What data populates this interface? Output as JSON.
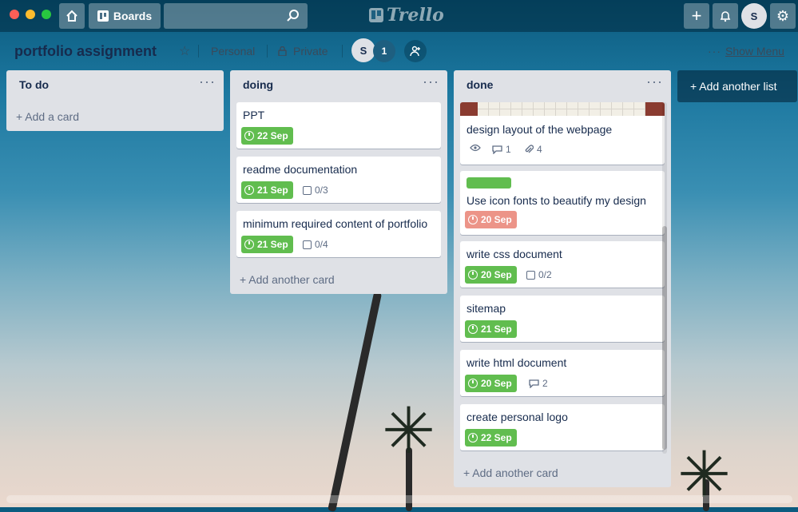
{
  "topbar": {
    "boards_label": "Boards",
    "logo_text": "Trello",
    "user_initial": "S",
    "search_placeholder": ""
  },
  "board": {
    "title": "portfolio assignment",
    "team": "Personal",
    "visibility": "Private",
    "member_initial": "S",
    "member_count": "1",
    "show_menu": "Show Menu"
  },
  "lists": {
    "todo": {
      "title": "To do",
      "add_label": "+ Add a card"
    },
    "doing": {
      "title": "doing",
      "add_label": "+ Add another card",
      "cards": [
        {
          "title": "PPT",
          "due": "22 Sep"
        },
        {
          "title": "readme documentation",
          "due": "21 Sep",
          "checklist": "0/3"
        },
        {
          "title": "minimum required content of portfolio",
          "due": "21 Sep",
          "checklist": "0/4"
        }
      ]
    },
    "done": {
      "title": "done",
      "add_label": "+ Add another card",
      "cards": [
        {
          "title": "design layout of the webpage",
          "comments": "1",
          "attachments": "4"
        },
        {
          "title": "Use icon fonts to beautify my design",
          "due": "20 Sep"
        },
        {
          "title": "write css document",
          "due": "20 Sep",
          "checklist": "0/2"
        },
        {
          "title": "sitemap",
          "due": "21 Sep"
        },
        {
          "title": "write html document",
          "due": "20 Sep",
          "comments": "2"
        },
        {
          "title": "create personal logo",
          "due": "22 Sep"
        }
      ]
    }
  },
  "add_list_label": "+ Add another list",
  "colors": {
    "due_green": "#61bd4f",
    "due_overdue": "#ec9488",
    "label_green": "#61bd4f"
  }
}
